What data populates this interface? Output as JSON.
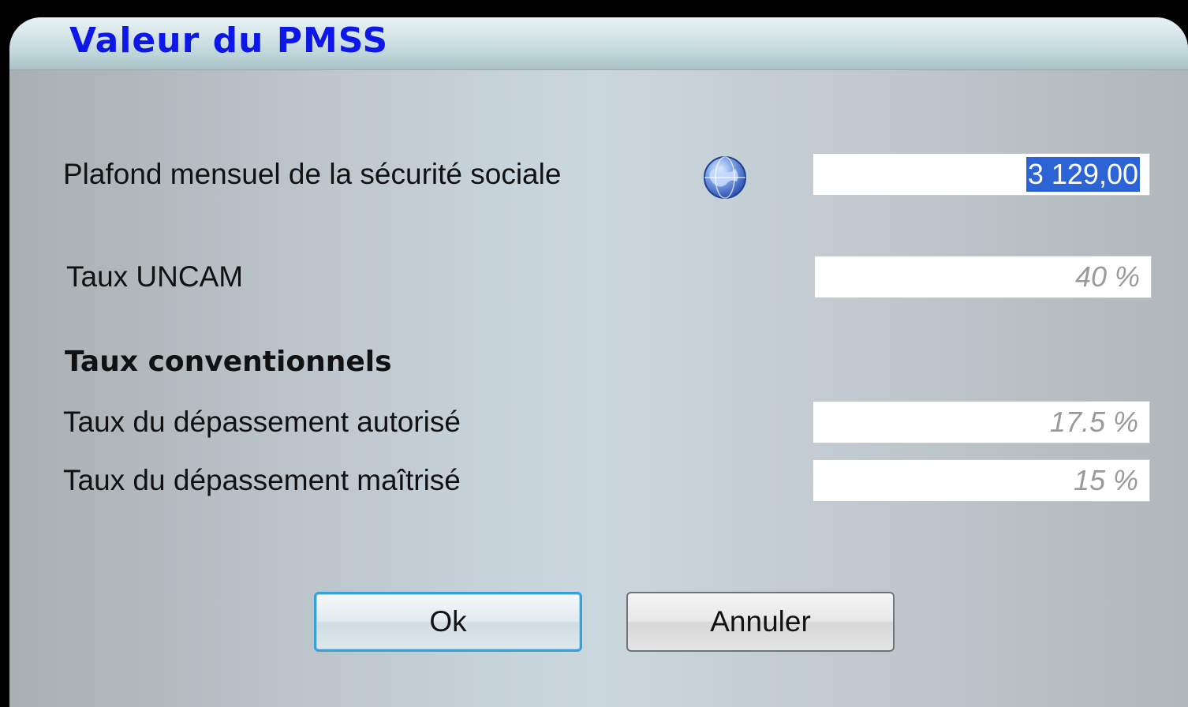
{
  "window": {
    "title": "Valeur du PMSS"
  },
  "form": {
    "pmss_label": "Plafond mensuel de la sécurité sociale",
    "pmss_value": "3 129,00",
    "globe_icon": "globe-icon",
    "uncam_label": "Taux UNCAM",
    "uncam_value": "40 %",
    "section_heading": "Taux conventionnels",
    "autorise_label": "Taux du dépassement autorisé",
    "autorise_value": "17.5 %",
    "maitrise_label": "Taux du dépassement maîtrisé",
    "maitrise_value": "15 %"
  },
  "buttons": {
    "ok_label": "Ok",
    "cancel_label": "Annuler"
  },
  "colors": {
    "title_text": "#0d18e8",
    "selection": "#2c64d6",
    "focus_border": "#3aa0d8"
  }
}
